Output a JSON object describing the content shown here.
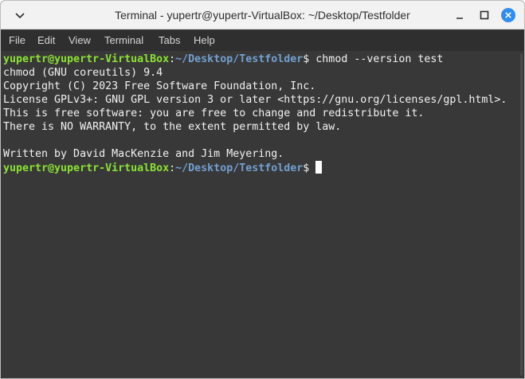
{
  "window": {
    "title": "Terminal - yupertr@yupertr-VirtualBox: ~/Desktop/Testfolder"
  },
  "menu": {
    "items": [
      "File",
      "Edit",
      "View",
      "Terminal",
      "Tabs",
      "Help"
    ]
  },
  "terminal": {
    "prompt_user": "yupertr@yupertr-VirtualBox",
    "prompt_sep": ":",
    "prompt_path": "~/Desktop/Testfolder",
    "prompt_symbol": "$",
    "command": "chmod --version test",
    "output": [
      "chmod (GNU coreutils) 9.4",
      "Copyright (C) 2023 Free Software Foundation, Inc.",
      "License GPLv3+: GNU GPL version 3 or later <https://gnu.org/licenses/gpl.html>.",
      "This is free software: you are free to change and redistribute it.",
      "There is NO WARRANTY, to the extent permitted by law.",
      "",
      "Written by David MacKenzie and Jim Meyering."
    ]
  },
  "colors": {
    "background": "#383838",
    "prompt_user": "#8ae234",
    "prompt_path": "#729fcf",
    "text": "#f2f2f2"
  }
}
